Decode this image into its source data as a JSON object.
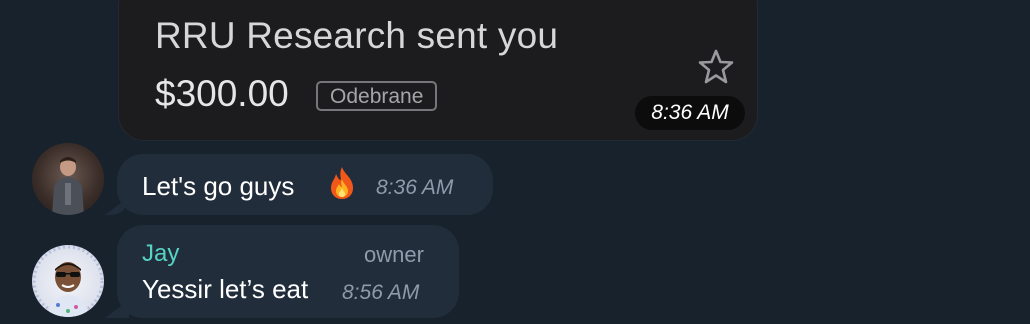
{
  "payment": {
    "title": "RRU Research sent you",
    "amount": "$300.00",
    "status": "Odebrane",
    "time": "8:36 AM",
    "star_icon": "star-outline-icon"
  },
  "messages": [
    {
      "avatar_icon": "user-avatar",
      "text": "Let's go guys",
      "emoji_icon": "fire-icon",
      "time": "8:36 AM"
    },
    {
      "avatar_icon": "user-avatar",
      "sender": "Jay",
      "role": "owner",
      "text": "Yessir let’s eat",
      "time": "8:56 AM"
    }
  ],
  "colors": {
    "background": "#18222d",
    "bubble": "#212d3b",
    "payment_card": "#1c1c1e",
    "sender_name": "#56d3c4",
    "secondary_text": "#8e9baa"
  }
}
